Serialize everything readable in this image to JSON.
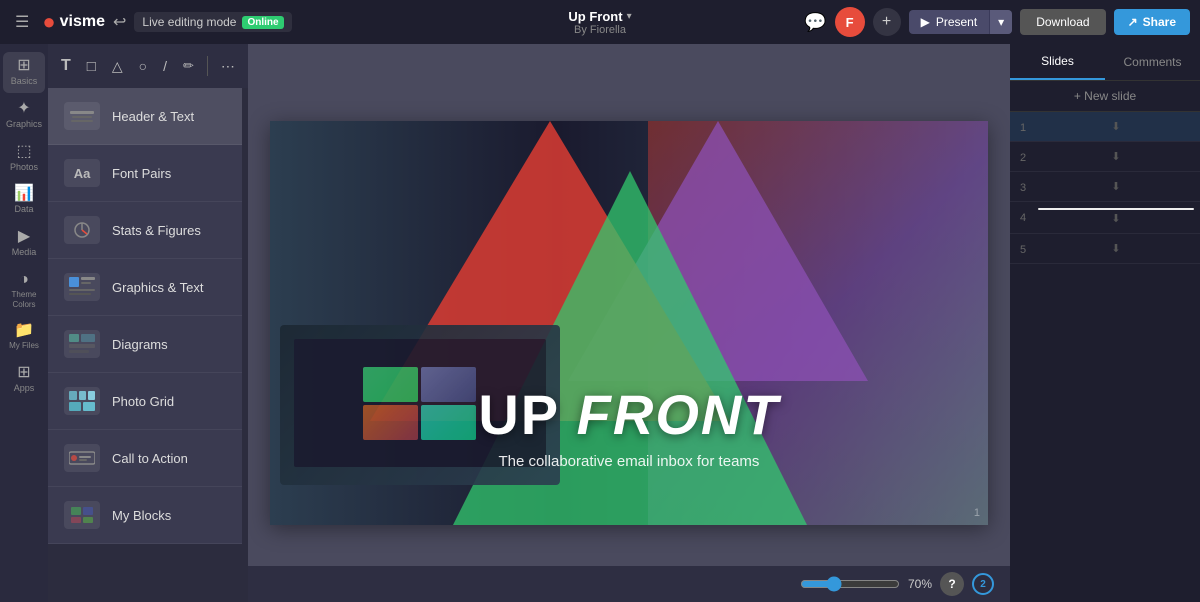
{
  "topbar": {
    "menu_icon": "☰",
    "logo_text": "visme",
    "undo_icon": "↩",
    "live_editing_label": "Live editing mode",
    "online_badge": "Online",
    "project_title": "Up Front",
    "project_chevron": "▾",
    "by_line": "By Fiorella",
    "comment_icon": "💬",
    "avatar_letter": "F",
    "add_icon": "+",
    "play_icon": "▶",
    "present_label": "Present",
    "present_dropdown": "▾",
    "download_label": "Download",
    "share_label": "Share",
    "share_icon": "↗"
  },
  "toolbar": {
    "text_tool": "T",
    "rect_tool": "□",
    "tri_tool": "△",
    "circle_tool": "○",
    "line_tool": "/",
    "draw_tool": "✏",
    "more_tool": "⋯"
  },
  "panel": {
    "items": [
      {
        "id": "header-text",
        "label": "Header & Text",
        "icon": "≡"
      },
      {
        "id": "font-pairs",
        "label": "Font Pairs",
        "icon": "Aa"
      },
      {
        "id": "stats-figures",
        "label": "Stats & Figures",
        "icon": "◎"
      },
      {
        "id": "graphics-text",
        "label": "Graphics & Text",
        "icon": "⊞"
      },
      {
        "id": "diagrams",
        "label": "Diagrams",
        "icon": "⊟"
      },
      {
        "id": "photo-grid",
        "label": "Photo Grid",
        "icon": "⊡"
      },
      {
        "id": "call-to-action",
        "label": "Call to Action",
        "icon": "⊕"
      },
      {
        "id": "my-blocks",
        "label": "My Blocks",
        "icon": "⊛"
      }
    ]
  },
  "left_icons": [
    {
      "id": "basics",
      "icon": "⊞",
      "label": "Basics"
    },
    {
      "id": "graphics",
      "icon": "★",
      "label": "Graphics"
    },
    {
      "id": "photos",
      "icon": "🖼",
      "label": "Photos"
    },
    {
      "id": "data",
      "icon": "📊",
      "label": "Data"
    },
    {
      "id": "media",
      "icon": "▶",
      "label": "Media"
    },
    {
      "id": "theme-colors",
      "icon": "🎨",
      "label": "Theme Colors"
    },
    {
      "id": "my-files",
      "icon": "📁",
      "label": "My Files"
    },
    {
      "id": "apps",
      "icon": "⊞",
      "label": "Apps"
    }
  ],
  "slide": {
    "title_part1": "UP ",
    "title_part2": "FRONT",
    "subtitle": "The collaborative email inbox for teams",
    "slide_number": "1"
  },
  "slides_panel": {
    "tabs": [
      "Slides",
      "Comments"
    ],
    "new_slide_label": "+ New slide",
    "slides": [
      {
        "num": "1",
        "active": true
      },
      {
        "num": "2",
        "active": false
      },
      {
        "num": "3",
        "active": false
      },
      {
        "num": "4",
        "active": false
      },
      {
        "num": "5",
        "active": false
      }
    ]
  },
  "zoom": {
    "level": "70%",
    "help": "?",
    "notification": "2"
  }
}
